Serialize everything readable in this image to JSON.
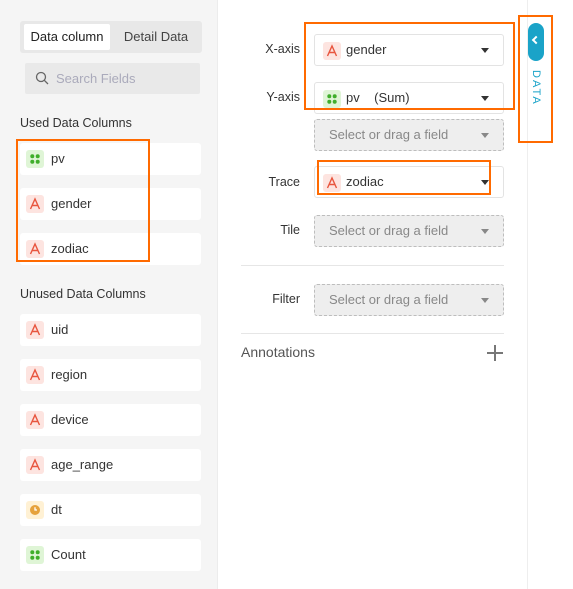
{
  "tabs": {
    "data_column": "Data column",
    "detail_data": "Detail Data"
  },
  "search": {
    "placeholder": "Search Fields",
    "value": ""
  },
  "used_columns": {
    "title": "Used Data Columns",
    "items": [
      {
        "name": "pv",
        "type": "measure"
      },
      {
        "name": "gender",
        "type": "dimension"
      },
      {
        "name": "zodiac",
        "type": "dimension"
      }
    ]
  },
  "unused_columns": {
    "title": "Unused Data Columns",
    "items": [
      {
        "name": "uid",
        "type": "dimension"
      },
      {
        "name": "region",
        "type": "dimension"
      },
      {
        "name": "device",
        "type": "dimension"
      },
      {
        "name": "age_range",
        "type": "dimension"
      },
      {
        "name": "dt",
        "type": "date"
      },
      {
        "name": "Count",
        "type": "measure"
      }
    ]
  },
  "config": {
    "x_axis": {
      "label": "X-axis",
      "value": "gender"
    },
    "y_axis": {
      "label": "Y-axis",
      "value": "pv    (Sum)",
      "placeholder": "Select or drag a field"
    },
    "trace": {
      "label": "Trace",
      "value": "zodiac"
    },
    "tile": {
      "label": "Tile",
      "placeholder": "Select or drag a field"
    },
    "filter": {
      "label": "Filter",
      "placeholder": "Select or drag a field"
    },
    "annotations": {
      "label": "Annotations"
    }
  },
  "side_tab": {
    "label": "DATA"
  },
  "colors": {
    "accent": "#1aa3c8",
    "highlight": "#ff6a00",
    "dimension_icon": "#e8553e",
    "measure_icon": "#3fae2a",
    "date_icon": "#e6a23c"
  },
  "icons": {
    "dimension": "letter-a-icon",
    "measure": "four-dots-icon",
    "date": "clock-icon",
    "search": "search-icon"
  }
}
